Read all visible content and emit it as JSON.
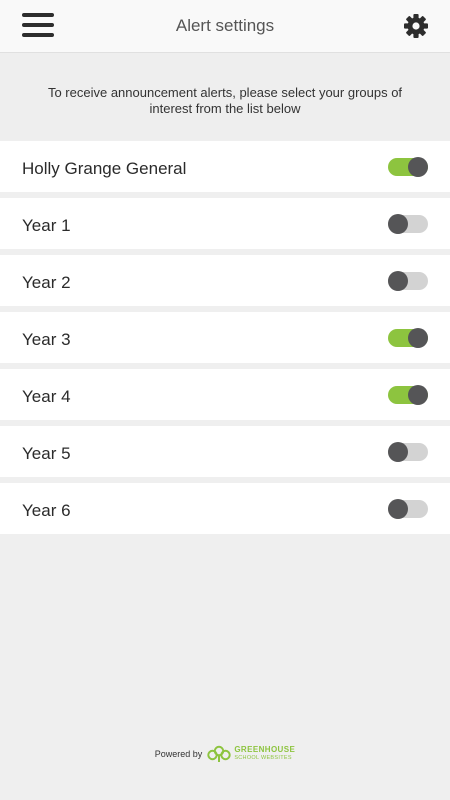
{
  "header": {
    "title": "Alert settings",
    "menu_icon": "hamburger-menu-icon",
    "settings_icon": "gear-icon"
  },
  "intro": {
    "text": "To receive announcement alerts, please select your groups of interest from the list below"
  },
  "groups": [
    {
      "label": "Holly Grange General",
      "enabled": true
    },
    {
      "label": "Year 1",
      "enabled": false
    },
    {
      "label": "Year 2",
      "enabled": false
    },
    {
      "label": "Year 3",
      "enabled": true
    },
    {
      "label": "Year 4",
      "enabled": true
    },
    {
      "label": "Year 5",
      "enabled": false
    },
    {
      "label": "Year 6",
      "enabled": false
    }
  ],
  "footer": {
    "powered_by": "Powered by",
    "brand_name": "GREENHOUSE",
    "brand_sub": "SCHOOL WEBSITES",
    "logo_icon": "greenhouse-logo-icon"
  },
  "colors": {
    "toggle_on": "#8dc43f",
    "toggle_off": "#d3d3d3",
    "knob": "#555557",
    "brand": "#8dc43f"
  }
}
